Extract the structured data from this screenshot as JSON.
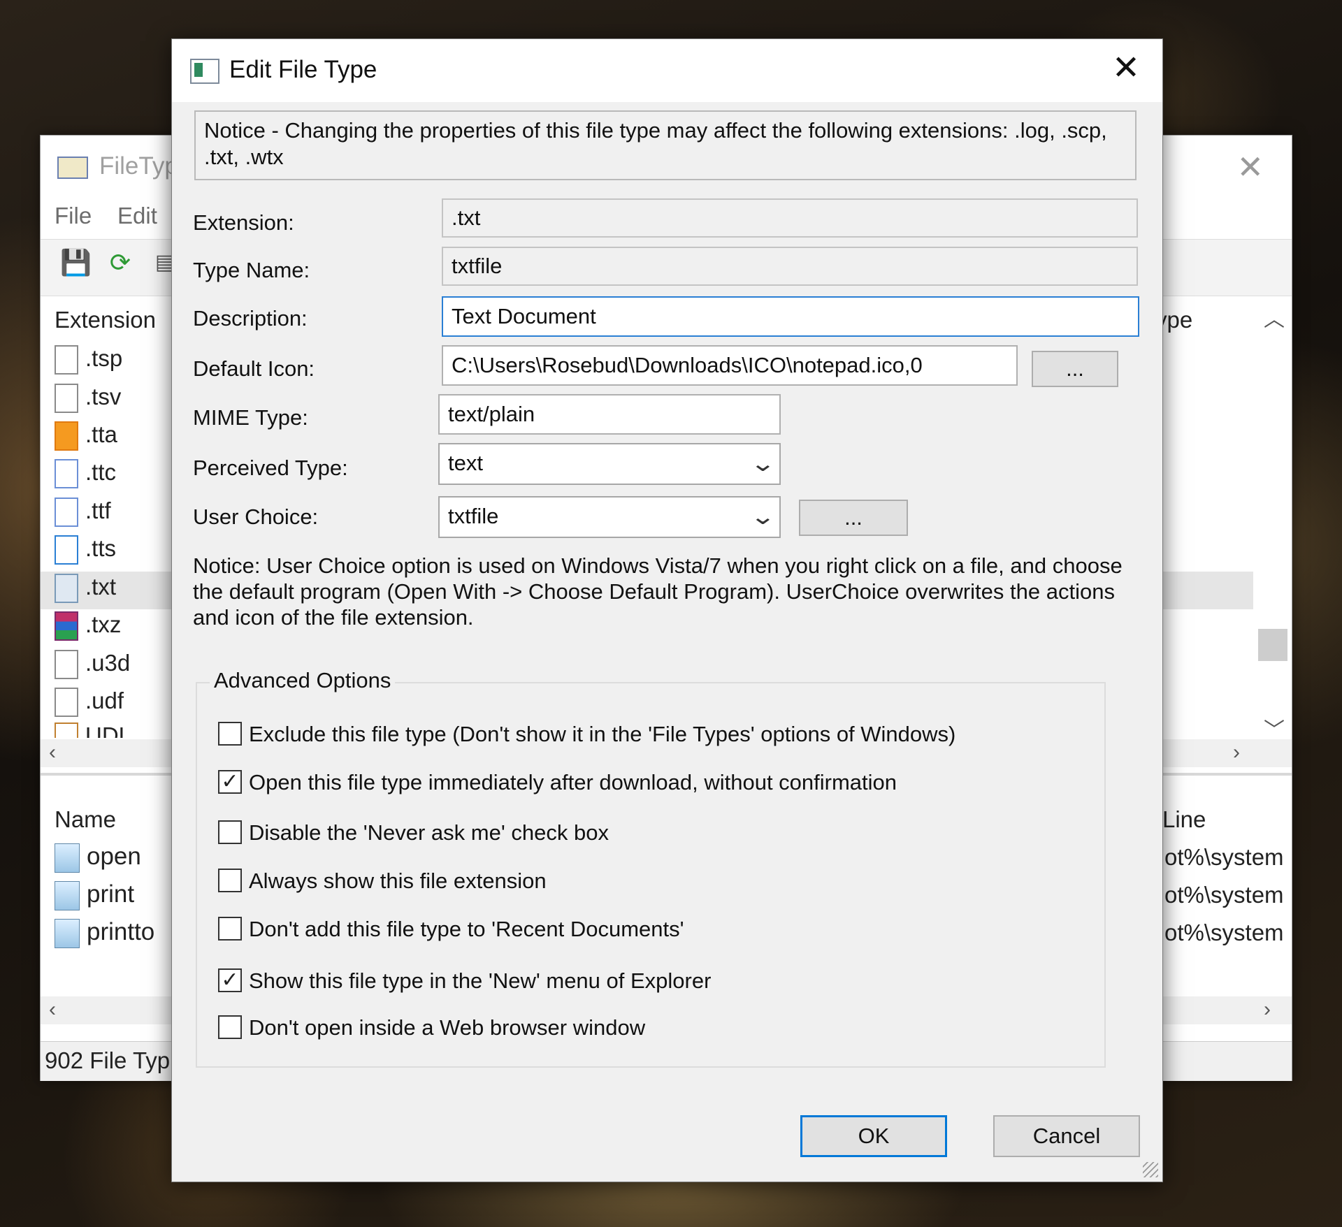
{
  "background_window": {
    "title": "FileTyp",
    "menu": [
      "File",
      "Edit"
    ],
    "extension_header": "Extension",
    "type_header_fragment": "ype",
    "extensions": [
      ".tsp",
      ".tsv",
      ".tta",
      ".ttc",
      ".ttf",
      ".tts",
      ".txt",
      ".txz",
      ".u3d",
      ".udf",
      "UDL"
    ],
    "selected_extension": ".txt",
    "name_header": "Name",
    "command_line_header": "Line",
    "actions": [
      "open",
      "print",
      "printto"
    ],
    "command_fragments": [
      "ot%\\system",
      "ot%\\system",
      "ot%\\system"
    ],
    "status": "902 File Typ"
  },
  "dialog": {
    "title": "Edit File Type",
    "notice": "Notice - Changing the properties of this file type may affect the following extensions: .log, .scp, .txt, .wtx",
    "extension_label": "Extension:",
    "extension_value": ".txt",
    "type_name_label": "Type Name:",
    "type_name_value": "txtfile",
    "description_label": "Description:",
    "description_value": "Text Document",
    "default_icon_label": "Default Icon:",
    "default_icon_value": "C:\\Users\\Rosebud\\Downloads\\ICO\\notepad.ico,0",
    "browse_label": "...",
    "mime_type_label": "MIME Type:",
    "mime_type_value": "text/plain",
    "perceived_type_label": "Perceived Type:",
    "perceived_type_value": "text",
    "user_choice_label": "User Choice:",
    "user_choice_value": "txtfile",
    "user_choice_browse_label": "...",
    "user_choice_info": "Notice: User Choice option is used on Windows Vista/7 when you right click on a file, and choose the default program (Open With -> Choose Default Program). UserChoice overwrites the actions and icon of the file extension.",
    "advanced_title": "Advanced Options",
    "options": [
      {
        "label": "Exclude  this file type (Don't show it in the 'File Types' options of Windows)",
        "checked": false
      },
      {
        "label": "Open this file type immediately after download, without confirmation",
        "checked": true
      },
      {
        "label": "Disable the 'Never ask me' check box",
        "checked": false
      },
      {
        "label": "Always show this file extension",
        "checked": false
      },
      {
        "label": "Don't add this file type to 'Recent Documents'",
        "checked": false
      },
      {
        "label": "Show this file type in the 'New' menu of Explorer",
        "checked": true
      },
      {
        "label": "Don't open inside a Web browser window",
        "checked": false
      }
    ],
    "ok_label": "OK",
    "cancel_label": "Cancel",
    "close_glyph": "✕",
    "check_glyph": "✓"
  }
}
